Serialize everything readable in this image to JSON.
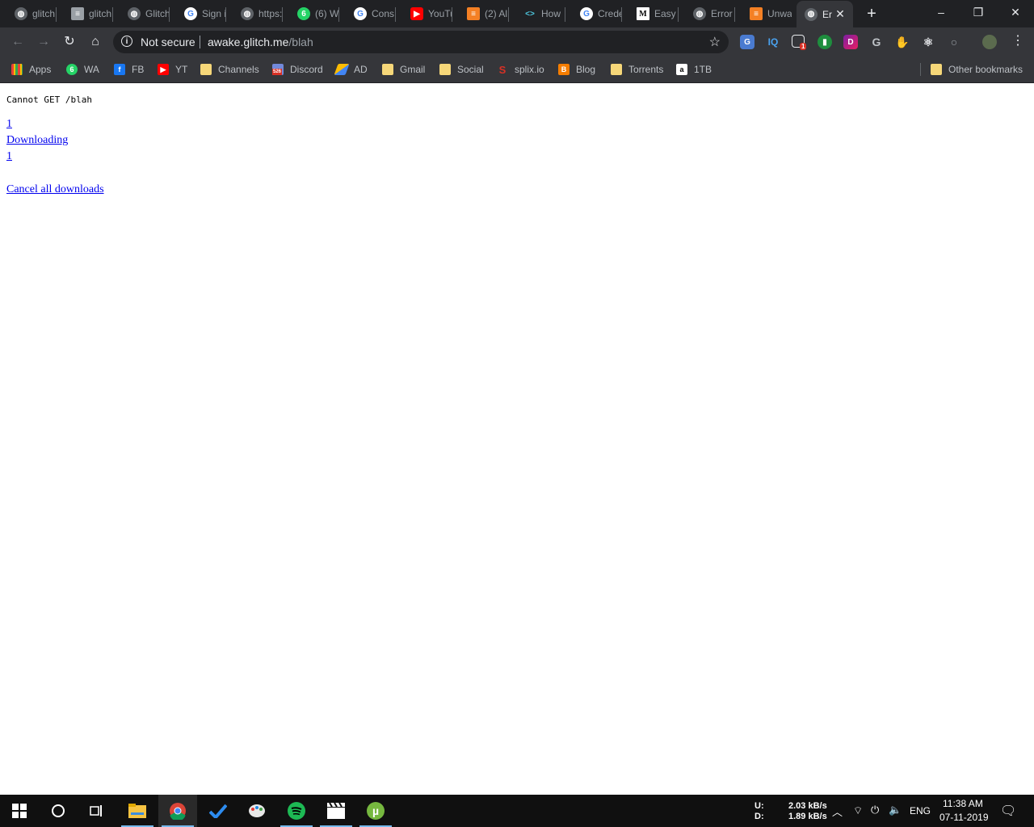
{
  "browser": {
    "tabs": [
      {
        "title": "glitch",
        "favicon": "globe-icon",
        "color": "#5f6368"
      },
      {
        "title": "glitch",
        "favicon": "stack-icon",
        "color": "#9aa0a6"
      },
      {
        "title": "Glitch",
        "favicon": "globe-icon",
        "color": "#5f6368"
      },
      {
        "title": "Sign i",
        "favicon": "google-icon",
        "color": "#ffffff"
      },
      {
        "title": "https:",
        "favicon": "globe-icon",
        "color": "#5f6368"
      },
      {
        "title": "(6) W",
        "favicon": "whatsapp-icon",
        "color": "#25d366"
      },
      {
        "title": "Cons",
        "favicon": "google-icon",
        "color": "#ffffff"
      },
      {
        "title": "YouTu",
        "favicon": "youtube-icon",
        "color": "#ff0000"
      },
      {
        "title": "(2) Al",
        "favicon": "stack-icon",
        "color": "#f48024"
      },
      {
        "title": "How",
        "favicon": "code-icon",
        "color": "#4ec9e1"
      },
      {
        "title": "Crede",
        "favicon": "google-icon",
        "color": "#ffffff"
      },
      {
        "title": "Easy",
        "favicon": "medium-icon",
        "color": "#000000"
      },
      {
        "title": "Error",
        "favicon": "globe-icon",
        "color": "#5f6368"
      },
      {
        "title": "Unwa",
        "favicon": "stack-icon",
        "color": "#f48024"
      }
    ],
    "active_tab": {
      "title": "Er",
      "favicon": "globe-icon"
    },
    "window_controls": {
      "minimize": "–",
      "restore": "❐",
      "close": "✕"
    },
    "new_tab": "+",
    "omnibox": {
      "security_label": "Not secure",
      "host": "awake.glitch.me",
      "path": "/blah"
    },
    "extensions": [
      {
        "name": "translate-icon",
        "label": "G",
        "color": "#4a7bd0"
      },
      {
        "name": "iq-icon",
        "label": "IQ",
        "color": "#35363a"
      },
      {
        "name": "screenshot-icon",
        "label": "",
        "color": "#35363a",
        "badge": "1"
      },
      {
        "name": "ext-green-icon",
        "label": "",
        "color": "#1e8e3e"
      },
      {
        "name": "ext-d-icon",
        "label": "D",
        "color": "#c2185b"
      },
      {
        "name": "grammarly-icon",
        "label": "G",
        "color": "#35363a"
      },
      {
        "name": "gnome-icon",
        "label": "",
        "color": "#35363a"
      },
      {
        "name": "react-icon",
        "label": "⚛",
        "color": "#35363a"
      },
      {
        "name": "circle-ext-icon",
        "label": "○",
        "color": "#35363a"
      }
    ],
    "bookmarks": [
      {
        "label": "Apps",
        "icon": "apps-grid-icon"
      },
      {
        "label": "WA",
        "icon": "whatsapp-icon"
      },
      {
        "label": "FB",
        "icon": "facebook-icon"
      },
      {
        "label": "YT",
        "icon": "youtube-icon"
      },
      {
        "label": "Channels",
        "icon": "folder-icon"
      },
      {
        "label": "Discord",
        "icon": "discord-icon"
      },
      {
        "label": "AD",
        "icon": "adsense-icon"
      },
      {
        "label": "Gmail",
        "icon": "folder-icon"
      },
      {
        "label": "Social",
        "icon": "folder-icon"
      },
      {
        "label": "splix.io",
        "icon": "splix-icon"
      },
      {
        "label": "Blog",
        "icon": "blogger-icon"
      },
      {
        "label": "Torrents",
        "icon": "folder-icon"
      },
      {
        "label": "1TB",
        "icon": "amazon-icon"
      }
    ],
    "other_bookmarks": "Other bookmarks",
    "discord_badge": "526"
  },
  "page": {
    "error_text": "Cannot GET /blah",
    "link1": "1",
    "link2": "Downloading",
    "link3": "1",
    "cancel_link": "Cancel all downloads"
  },
  "taskbar": {
    "net_upload_label": "U:",
    "net_download_label": "D:",
    "upload_speed": "2.03 kB/s",
    "download_speed": "1.89 kB/s",
    "language": "ENG",
    "time": "11:38 AM",
    "date": "07-11-2019"
  }
}
